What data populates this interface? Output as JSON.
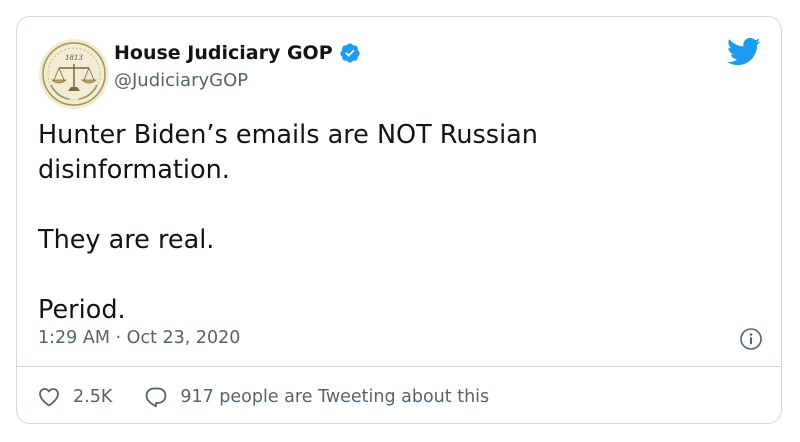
{
  "tweet": {
    "author": {
      "display_name": "House Judiciary GOP",
      "handle": "@JudiciaryGOP",
      "avatar_year": "1813",
      "verified": true
    },
    "text": "Hunter Biden’s emails are NOT Russian\ndisinformation.\n\nThey are real.\n\nPeriod.",
    "time": "1:29 AM",
    "separator": "·",
    "date": "Oct 23, 2020",
    "likes": "2.5K",
    "replies_label": "917 people are Tweeting about this"
  },
  "colors": {
    "accent": "#1d9bf0",
    "text_primary": "#0f1419",
    "text_secondary": "#536471",
    "border": "#cfd9de",
    "seal_cream": "#f3ecd5",
    "seal_gold": "#a8924f"
  },
  "icons": {
    "logo": "twitter-bird-icon",
    "verified": "verified-badge-icon",
    "info": "info-icon",
    "like": "heart-icon",
    "reply": "reply-bubble-icon"
  }
}
